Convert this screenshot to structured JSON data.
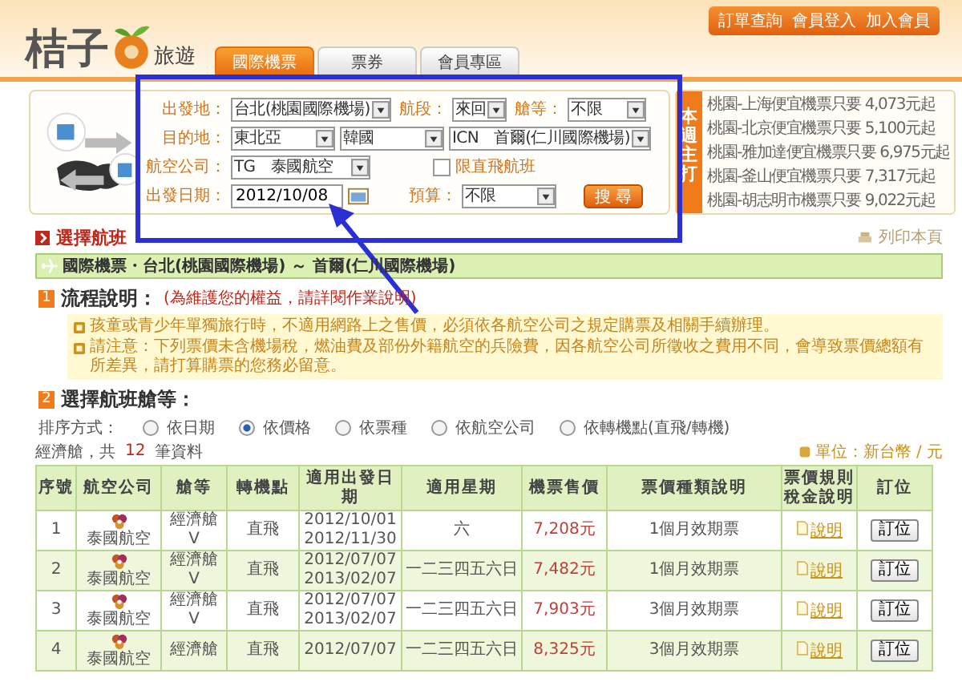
{
  "header": {
    "logo_text": "桔子",
    "logo_subtext": "旅遊",
    "links": [
      "訂單查詢",
      "會員登入",
      "加入會員"
    ],
    "tabs": [
      {
        "label": "國際機票",
        "selected": true
      },
      {
        "label": "票券",
        "selected": false
      },
      {
        "label": "會員專區",
        "selected": false
      }
    ]
  },
  "search": {
    "origin": {
      "label": "出發地：",
      "value": "台北(桃園國際機場)"
    },
    "trip": {
      "label": "航段：",
      "value": "來回"
    },
    "cabin": {
      "label": "艙等：",
      "value": "不限"
    },
    "destination": {
      "label": "目的地：",
      "values": [
        "東北亞",
        "韓國",
        "ICN　首爾(仁川國際機場)"
      ]
    },
    "airline": {
      "label": "航空公司：",
      "value": "TG　泰國航空"
    },
    "direct_only": {
      "label": "限直飛航班",
      "checked": false
    },
    "date": {
      "label": "出發日期：",
      "value": "2012/10/08"
    },
    "budget": {
      "label": "預算：",
      "value": "不限"
    },
    "search_button": "搜 尋"
  },
  "promo": {
    "title": "本週主打",
    "items": [
      "桃園-上海便宜機票只要 4,073元起",
      "桃園-北京便宜機票只要 5,100元起",
      "桃園-雅加達便宜機票只要 6,975元起",
      "桃園-釜山便宜機票只要 7,317元起",
      "桃園-胡志明市機票只要 9,022元起"
    ]
  },
  "section_title": "選擇航班",
  "print_link": "列印本頁",
  "route": "國際機票・台北(桃園國際機場) ～ 首爾(仁川國際機場)",
  "step1": {
    "number": "1",
    "title": "流程說明：",
    "note": "(為維護您的權益，請詳閱作業說明)"
  },
  "notes": [
    "孩童或青少年單獨旅行時，不適用網路上之售價，必須依各航空公司之規定購票及相關手續辦理。",
    "請注意：下列票價未含機場稅，燃油費及部份外籍航空的兵險費，因各航空公司所徵收之費用不同，會導致票價總額有所差異，請打算購票的您務必留意。"
  ],
  "step2": {
    "number": "2",
    "title": "選擇航班艙等："
  },
  "sort": {
    "label": "排序方式：",
    "options": [
      {
        "label": "依日期",
        "selected": false
      },
      {
        "label": "依價格",
        "selected": true
      },
      {
        "label": "依票種",
        "selected": false
      },
      {
        "label": "依航空公司",
        "selected": false
      },
      {
        "label": "依轉機點(直飛/轉機)",
        "selected": false
      }
    ]
  },
  "count": {
    "prefix": "經濟艙，共",
    "number": "12",
    "suffix": "筆資料"
  },
  "unit": "單位：新台幣 / 元",
  "table": {
    "columns": [
      [
        "序號"
      ],
      [
        "航空公司"
      ],
      [
        "艙等"
      ],
      [
        "轉機點"
      ],
      [
        "適用出發日期"
      ],
      [
        "適用星期"
      ],
      [
        "機票售價"
      ],
      [
        "票價種類說明"
      ],
      [
        "票價規則",
        "稅金說明"
      ],
      [
        "訂位"
      ]
    ],
    "rows": [
      {
        "no": "1",
        "airline": "泰國航空",
        "cabin": [
          "經濟艙",
          "V"
        ],
        "transfer": "直飛",
        "dates": [
          "2012/10/01",
          "2012/11/30"
        ],
        "days": "六",
        "price": "7,208元",
        "fare": [
          "1個月效期票"
        ],
        "rule_link": "說明",
        "book": "訂位"
      },
      {
        "no": "2",
        "airline": "泰國航空",
        "cabin": [
          "經濟艙",
          "V"
        ],
        "transfer": "直飛",
        "dates": [
          "2012/07/07",
          "2013/02/07"
        ],
        "days": "一二三四五六日",
        "price": "7,482元",
        "fare": [
          "1個月效期票"
        ],
        "rule_link": "說明",
        "book": "訂位"
      },
      {
        "no": "3",
        "airline": "泰國航空",
        "cabin": [
          "經濟艙",
          "V"
        ],
        "transfer": "直飛",
        "dates": [
          "2012/07/07",
          "2013/02/07"
        ],
        "days": "一二三四五六日",
        "price": "7,903元",
        "fare": [
          "3個月效期票"
        ],
        "rule_link": "說明",
        "book": "訂位"
      },
      {
        "no": "4",
        "airline": "泰國航空",
        "cabin": [
          "經濟艙"
        ],
        "transfer": "直飛",
        "dates": [
          "2012/07/07"
        ],
        "days": "一二三四五六日",
        "price": "8,325元",
        "fare": [
          "3個月效期票"
        ],
        "rule_link": "說明",
        "book": "訂位"
      }
    ]
  }
}
